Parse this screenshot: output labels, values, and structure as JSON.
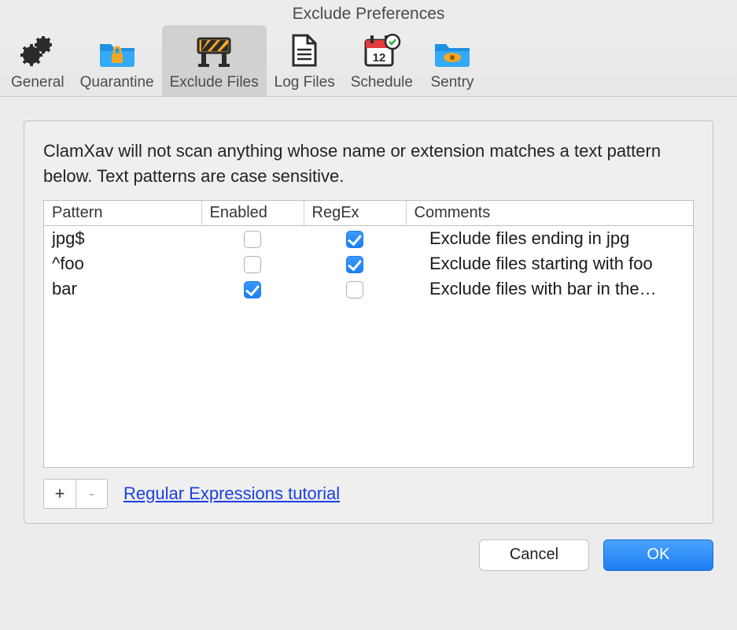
{
  "window": {
    "title": "Exclude Preferences"
  },
  "toolbar": {
    "items": [
      {
        "label": "General",
        "icon": "gears-icon",
        "selected": false
      },
      {
        "label": "Quarantine",
        "icon": "lock-folder-icon",
        "selected": false
      },
      {
        "label": "Exclude Files",
        "icon": "barrier-icon",
        "selected": true
      },
      {
        "label": "Log Files",
        "icon": "document-icon",
        "selected": false
      },
      {
        "label": "Schedule",
        "icon": "calendar-icon",
        "selected": false
      },
      {
        "label": "Sentry",
        "icon": "eye-folder-icon",
        "selected": false
      }
    ]
  },
  "panel": {
    "description": "ClamXav will not scan anything whose name or extension matches a text pattern below. Text patterns are case sensitive.",
    "columns": {
      "pattern": "Pattern",
      "enabled": "Enabled",
      "regex": "RegEx",
      "comments": "Comments"
    },
    "rows": [
      {
        "pattern": "jpg$",
        "enabled": false,
        "regex": true,
        "comments": "Exclude files ending in jpg"
      },
      {
        "pattern": "^foo",
        "enabled": false,
        "regex": true,
        "comments": "Exclude files starting with foo"
      },
      {
        "pattern": "bar",
        "enabled": true,
        "regex": false,
        "comments": "Exclude files with bar in the…"
      }
    ],
    "add_label": "+",
    "remove_label": "-",
    "tutorial_link": "Regular Expressions tutorial"
  },
  "footer": {
    "cancel": "Cancel",
    "ok": "OK"
  },
  "colors": {
    "accent": "#1d7ef0",
    "link": "#1a3fe0"
  }
}
